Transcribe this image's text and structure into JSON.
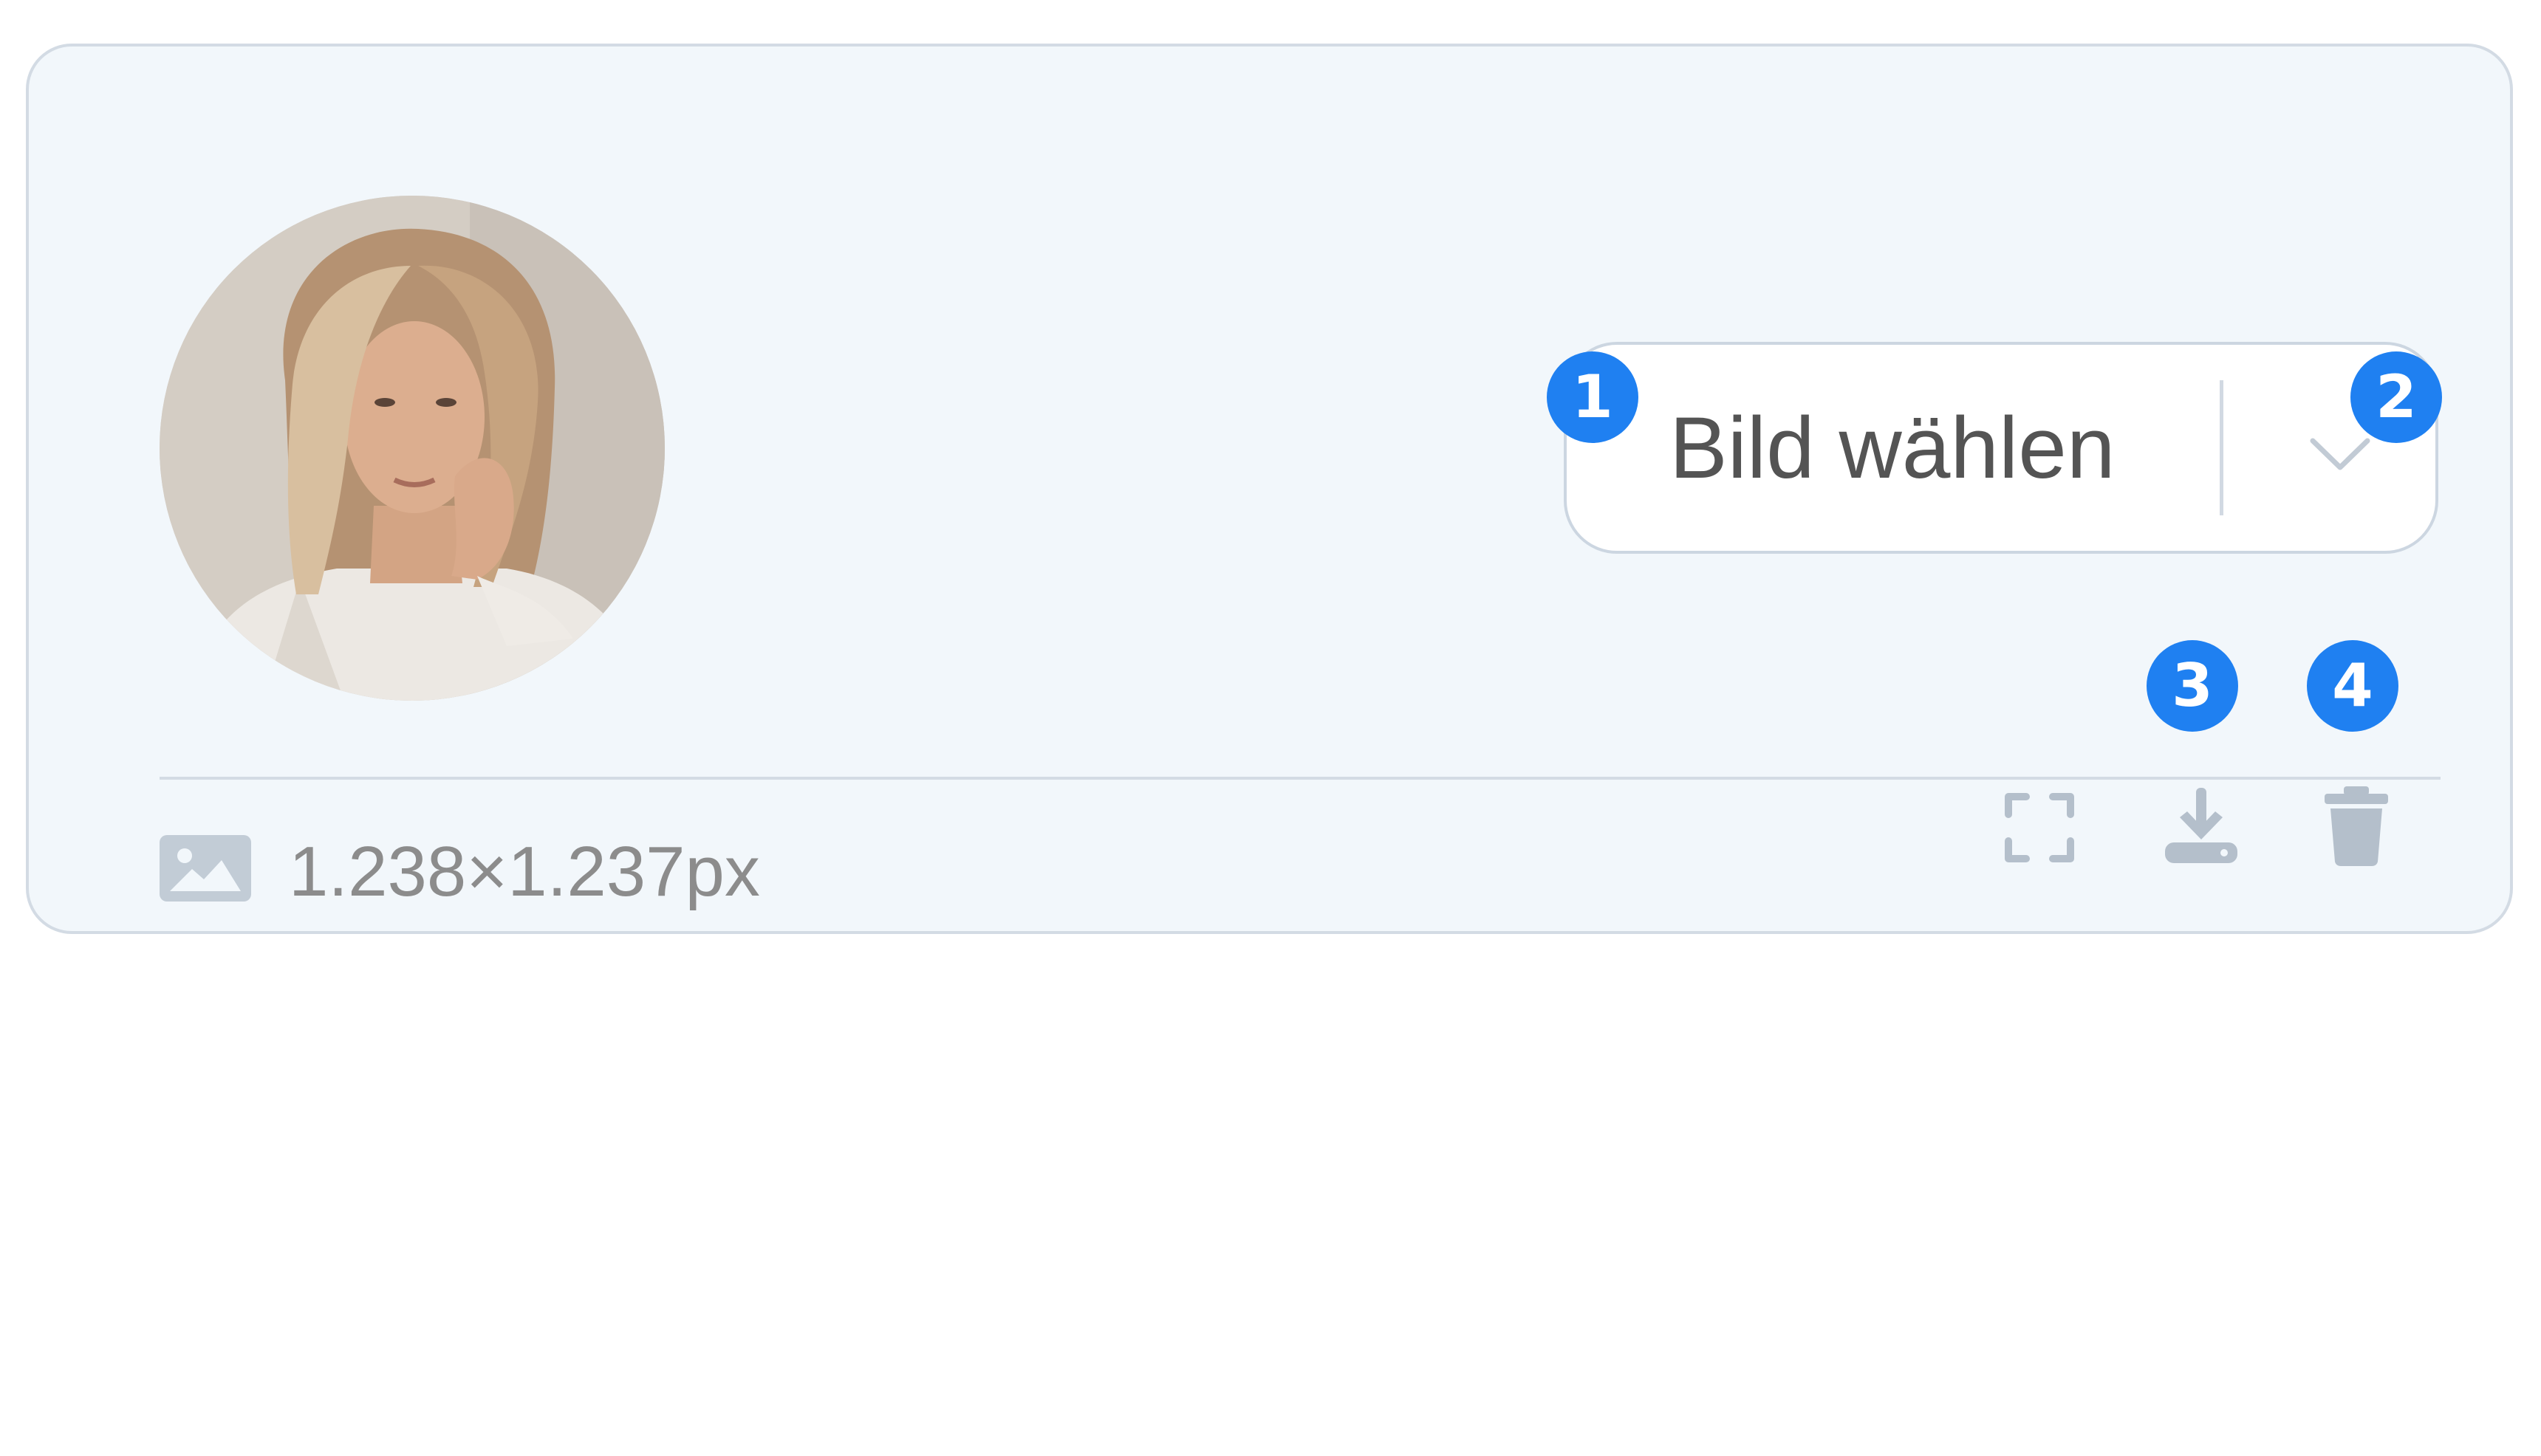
{
  "image_field": {
    "avatar_alt": "Profilbild",
    "select_button_label": "Bild wählen",
    "dropdown_icon": "chevron-down-icon",
    "dimensions": "1.238×1.237px",
    "dimensions_icon": "image-icon",
    "actions": [
      {
        "icon": "fullscreen-icon"
      },
      {
        "icon": "download-icon"
      },
      {
        "icon": "trash-icon"
      }
    ]
  },
  "annotations": [
    "1",
    "2",
    "3",
    "4"
  ],
  "colors": {
    "card_background": "#f2f7fb",
    "card_border": "#d3dbe4",
    "badge": "#1f80f1",
    "icon_muted": "#b4bfcb",
    "text": "#545454",
    "text_muted": "#8c8c8c"
  }
}
